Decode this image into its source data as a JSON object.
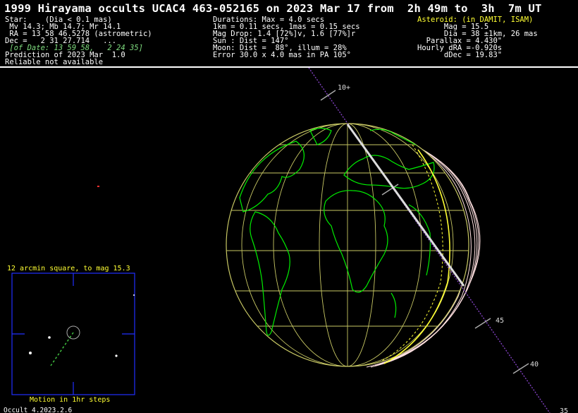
{
  "title": "1999 Hirayama occults UCAC4 463-052165 on 2023 Mar 17 from  2h 49m to  3h  7m UT",
  "star": {
    "l1": "Star:    (Dia < 0.1 mas)",
    "l2": " Mv 14.3; Mb 14.7; Mr 14.1",
    "l3": " RA = 13 58 46.5278 (astrometric)",
    "l4": "Dec =   2 31 27.714   ...",
    "l5": " [of Date: 13 59 58,   2 24 35]",
    "l6": "Prediction of 2023 Mar  1.0",
    "l7": "Reliable not available"
  },
  "event": {
    "l1": "Durations: Max = 4.0 secs",
    "l2": "1km = 0.11 secs, 1mas = 0.15 secs",
    "l3": "Mag Drop: 1.4 [72%]v, 1.6 [77%]r",
    "l4": "Sun : Dist = 147°",
    "l5": "Moon: Dist =  88°, illum = 28%",
    "l6": "Error 30.0 x 4.0 mas in PA 105°"
  },
  "asteroid": {
    "l1": "Asteroid: (in DAMIT, ISAM)",
    "l2": "      Mag = 15.5",
    "l3": "      Dia = 38 ±1km, 26 mas",
    "l4": "  Parallax = 4.430\"",
    "l5": "Hourly dRA =-0.920s",
    "l6": "      dDec = 19.83\""
  },
  "path_labels": {
    "top": "10+",
    "mid1": "45",
    "mid2": "40",
    "corner": "35"
  },
  "finder": {
    "caption": "12 arcmin square, to mag 15.3",
    "motion": "Motion in 1hr steps"
  },
  "version": "Occult 4.2023.2.6",
  "colors": {
    "background": "#000000",
    "text": "#ffffff",
    "highlight": "#ffff33",
    "coast": "#00ff00",
    "grid": "#c8c864",
    "shadow_path": "#dddddd",
    "center_line": "#8040c0"
  }
}
